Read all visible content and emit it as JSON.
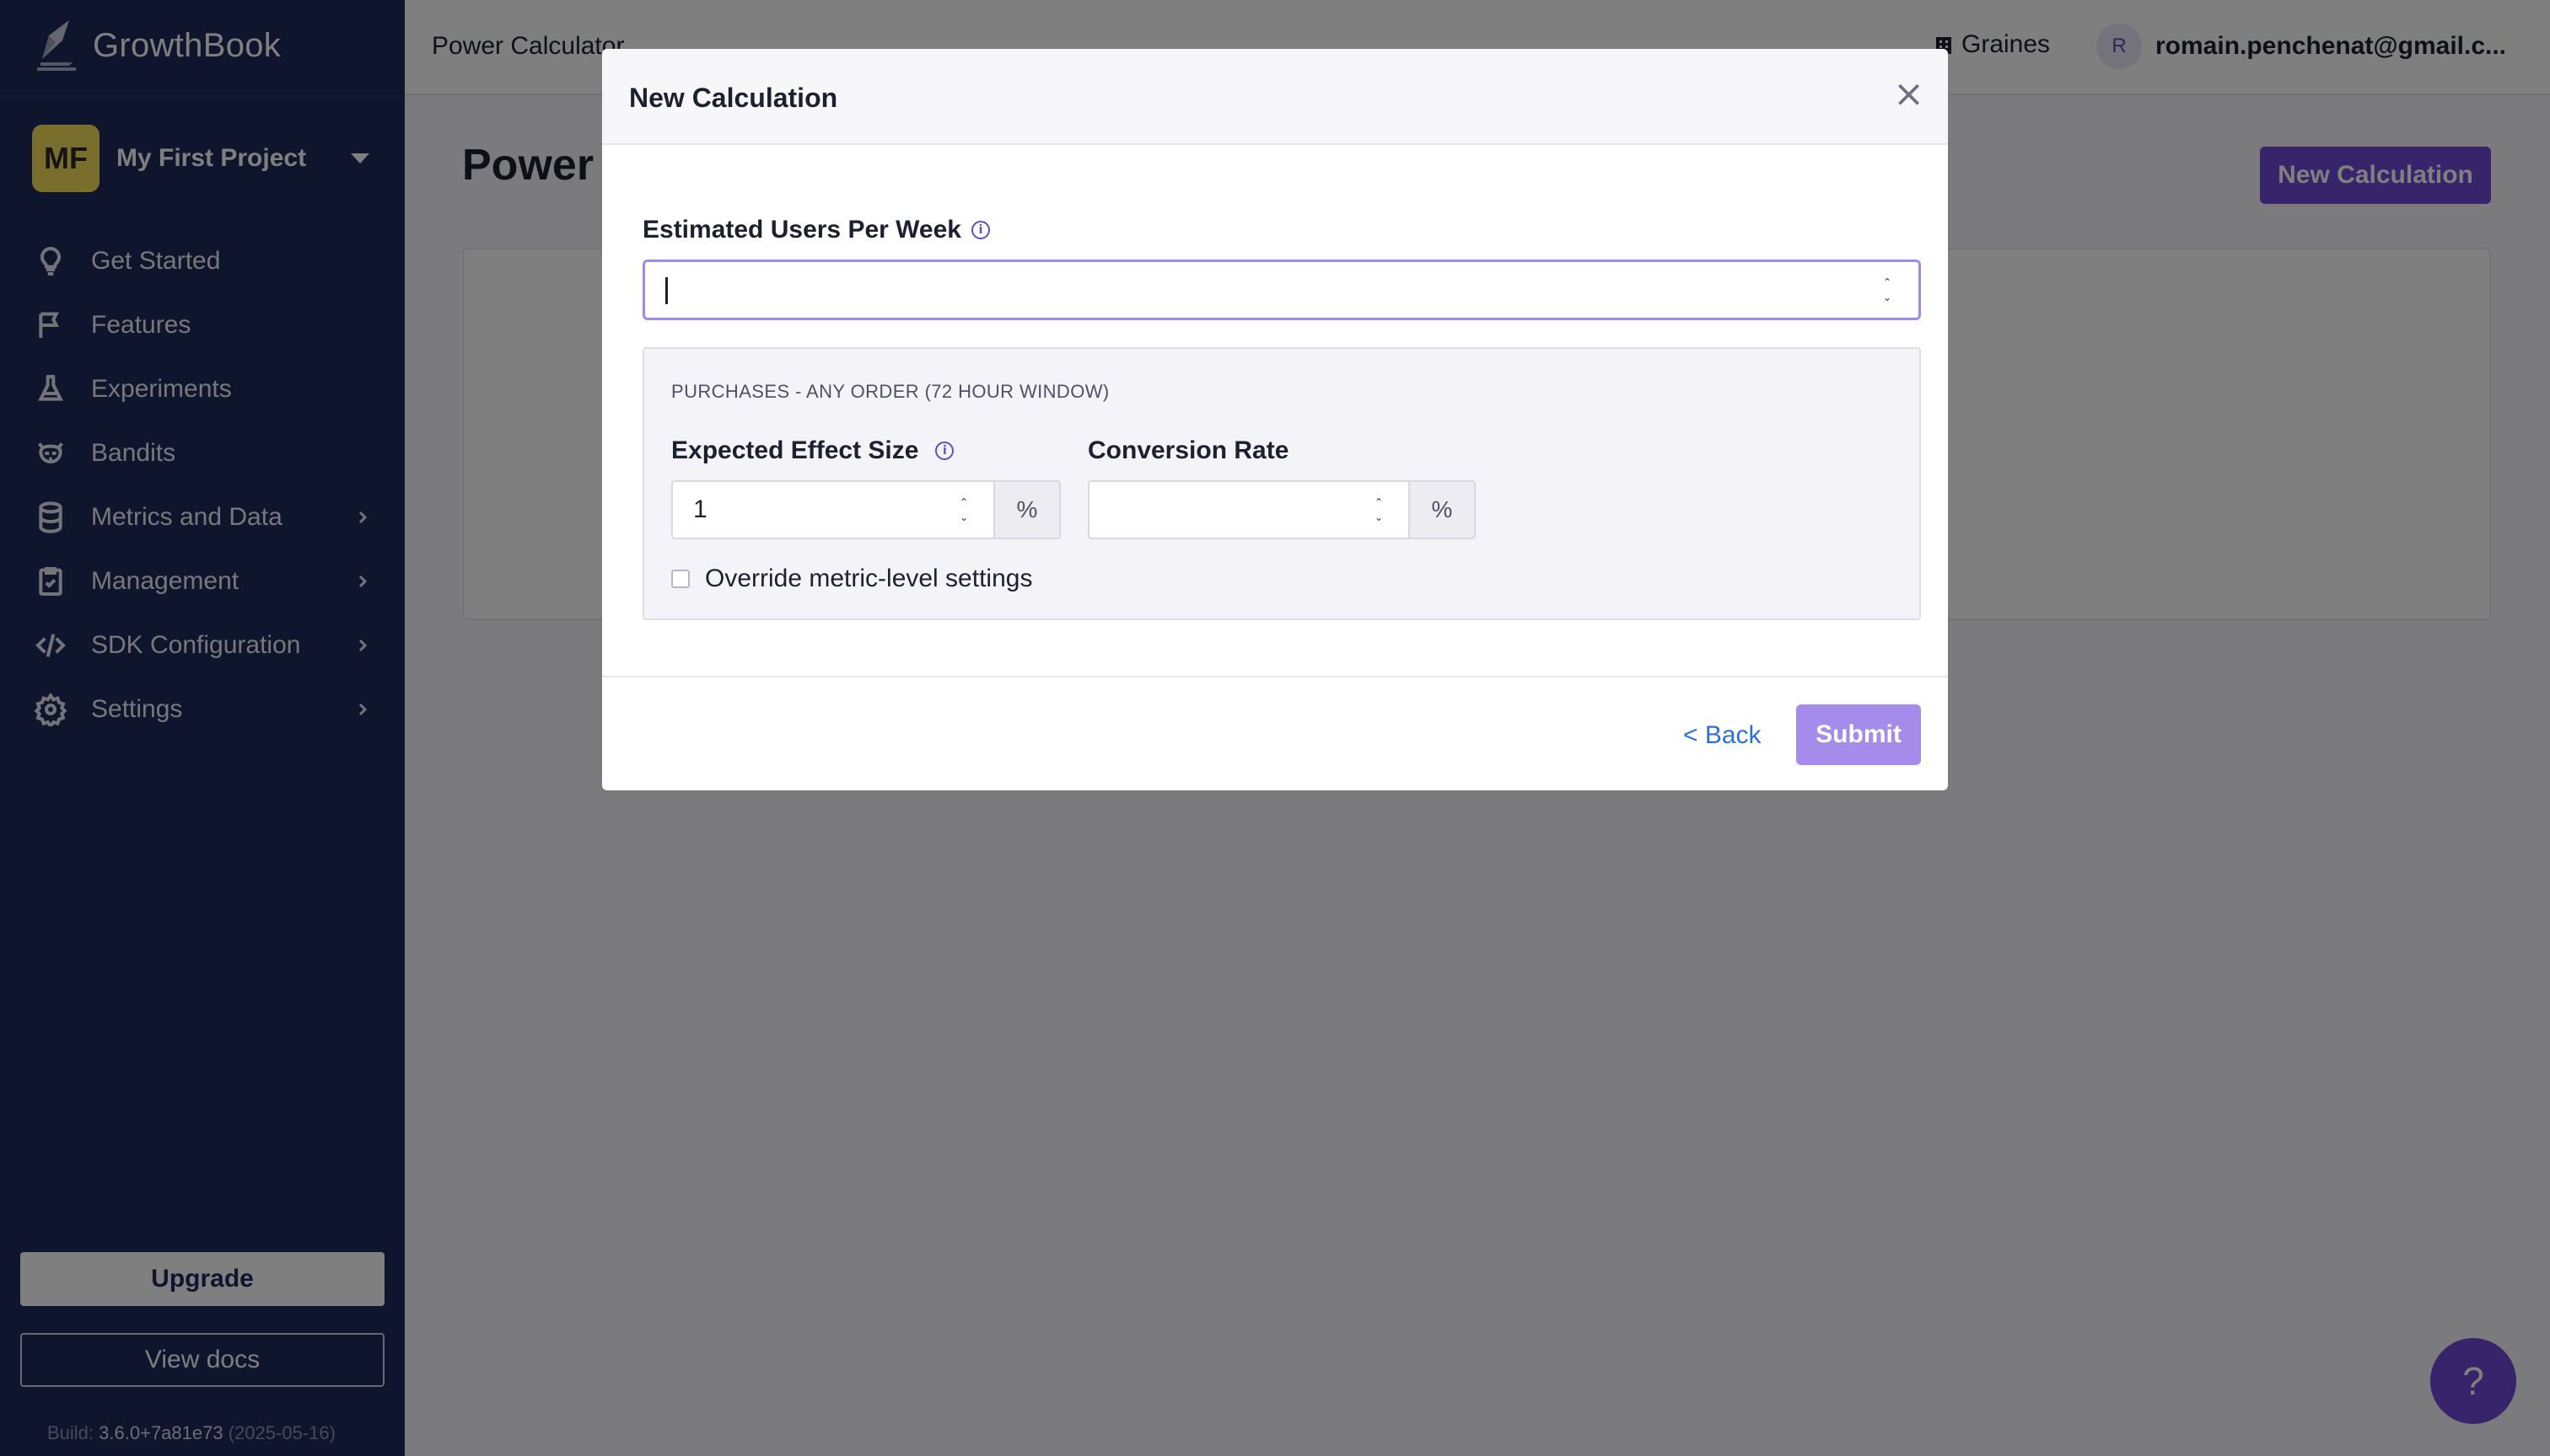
{
  "app": {
    "name": "GrowthBook"
  },
  "sidebar": {
    "project": {
      "initials": "MF",
      "name": "My First Project"
    },
    "items": [
      {
        "label": "Get Started",
        "icon": "lightbulb-icon",
        "has_submenu": false
      },
      {
        "label": "Features",
        "icon": "flag-icon",
        "has_submenu": false
      },
      {
        "label": "Experiments",
        "icon": "flask-icon",
        "has_submenu": false
      },
      {
        "label": "Bandits",
        "icon": "raccoon-icon",
        "has_submenu": false
      },
      {
        "label": "Metrics and Data",
        "icon": "database-icon",
        "has_submenu": true
      },
      {
        "label": "Management",
        "icon": "clipboard-icon",
        "has_submenu": true
      },
      {
        "label": "SDK Configuration",
        "icon": "code-icon",
        "has_submenu": true
      },
      {
        "label": "Settings",
        "icon": "gear-icon",
        "has_submenu": true
      }
    ],
    "upgrade_label": "Upgrade",
    "docs_label": "View docs",
    "build_prefix": "Build:",
    "build_version": "3.6.0+7a81e73",
    "build_date": "(2025-05-16)"
  },
  "topbar": {
    "breadcrumb": "Power Calculator",
    "org": "Graines",
    "user_initial": "R",
    "user_email": "romain.penchenat@gmail.c..."
  },
  "main": {
    "title": "Power Calculator",
    "new_calc_label": "New Calculation"
  },
  "help": {
    "label": "?"
  },
  "modal": {
    "title": "New Calculation",
    "close_label": "×",
    "users_label": "Estimated Users Per Week",
    "users_value": "",
    "metric": {
      "title": "PURCHASES - ANY ORDER (72 HOUR WINDOW)",
      "effect_label": "Expected Effect Size",
      "effect_value": "1",
      "effect_unit": "%",
      "conversion_label": "Conversion Rate",
      "conversion_value": "",
      "conversion_unit": "%",
      "override_label": "Override metric-level settings",
      "override_checked": false
    },
    "back_label": "< Back",
    "submit_label": "Submit"
  },
  "colors": {
    "sidebar_bg": "#1e2a5a",
    "primary": "#6e48d6",
    "submit_disabled": "#a58bea",
    "link": "#2c6fd8",
    "project_avatar": "#f3dd59"
  }
}
